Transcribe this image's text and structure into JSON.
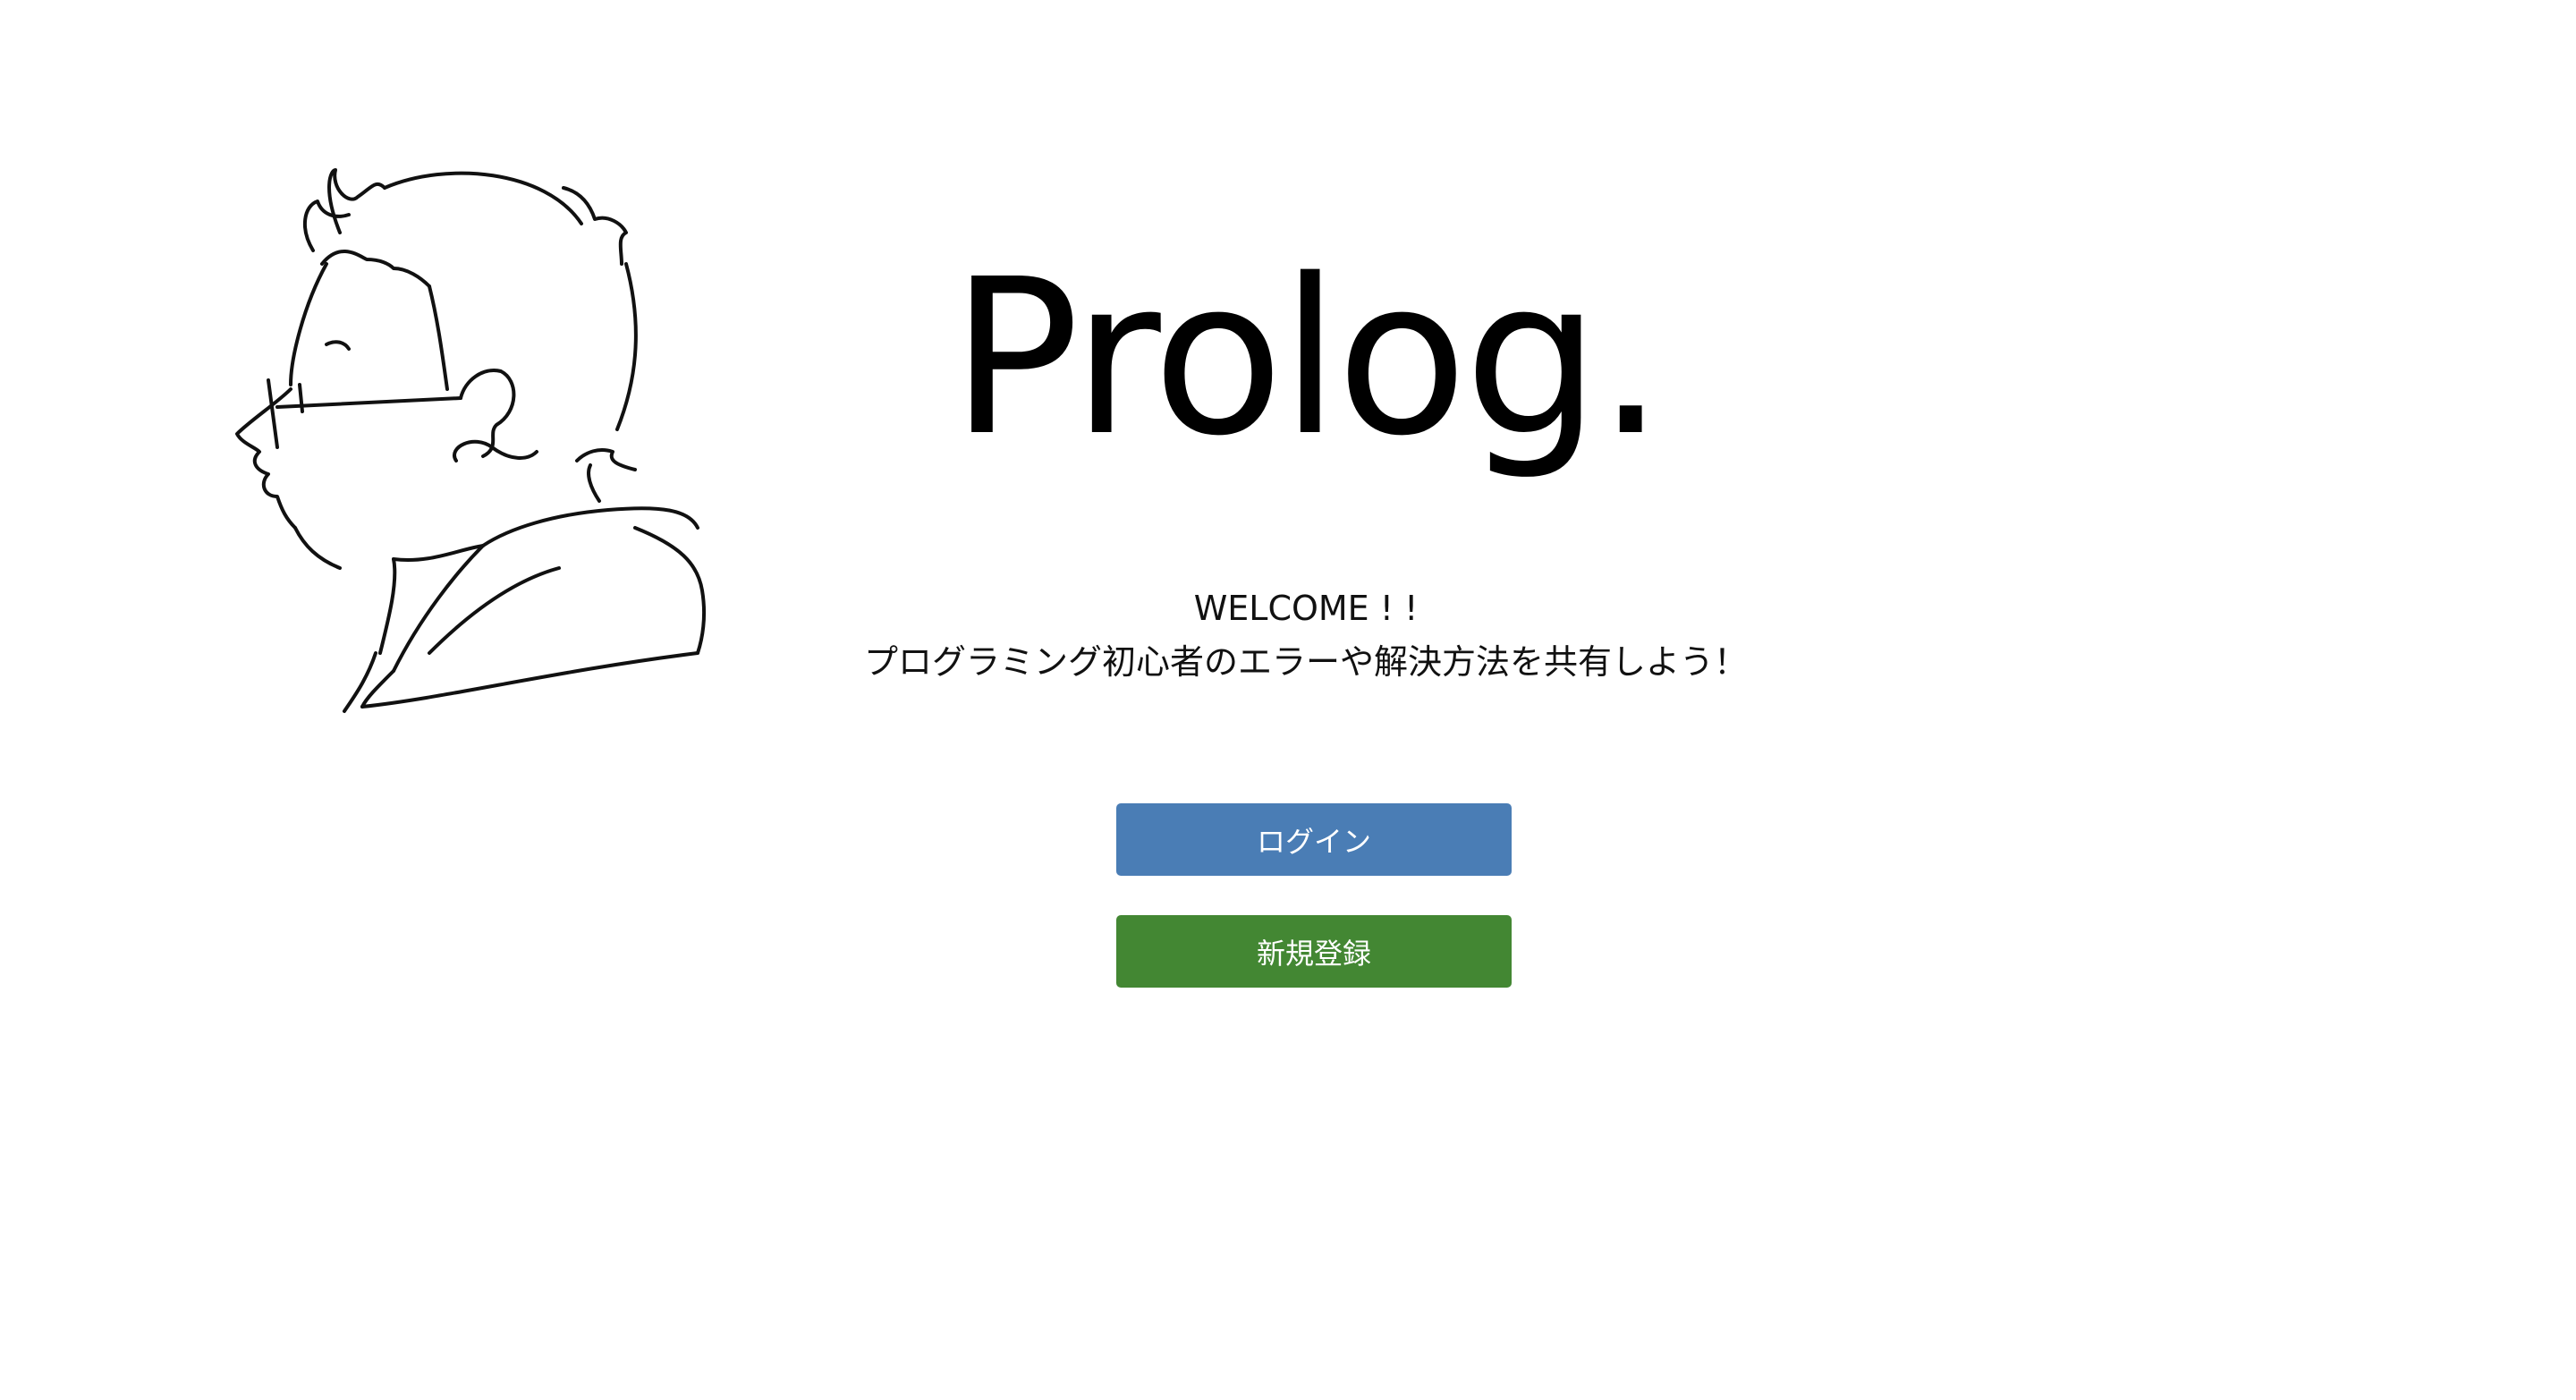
{
  "app": {
    "title": "Prolog."
  },
  "hero": {
    "welcome": "WELCOME ! !",
    "tagline": "プログラミング初心者のエラーや解決方法を共有しよう！"
  },
  "actions": {
    "login_label": "ログイン",
    "signup_label": "新規登録"
  },
  "colors": {
    "login_button": "#4a7db5",
    "signup_button": "#438733",
    "background": "#ffffff",
    "text": "#000000"
  },
  "illustration": {
    "icon": "person-profile-sketch"
  }
}
